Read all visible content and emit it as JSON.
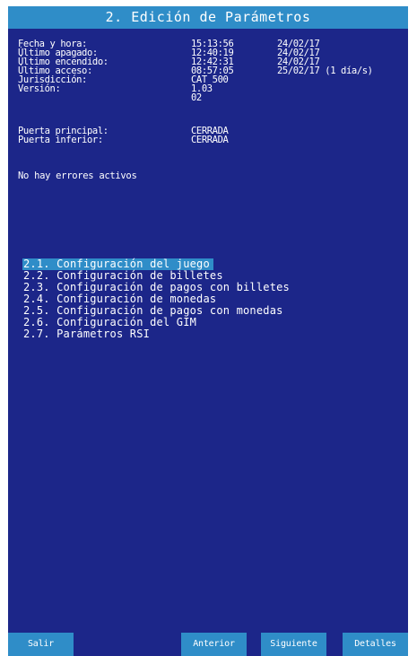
{
  "title": "2. Edición de Parámetros",
  "info": {
    "fecha_hora": {
      "label": "Fecha y hora:",
      "time": "15:13:56",
      "date": "24/02/17"
    },
    "ultimo_apagado": {
      "label": "Último apagado:",
      "time": "12:40:19",
      "date": "24/02/17"
    },
    "ultimo_encendido": {
      "label": "Último encendido:",
      "time": "12:42:31",
      "date": "24/02/17"
    },
    "ultimo_acceso": {
      "label": "Último acceso:",
      "time": "08:57:05",
      "date": "25/02/17 (1 día/s)"
    },
    "jurisdiccion": {
      "label": "Jurisdicción:",
      "value": "CAT 500"
    },
    "version": {
      "label": "Versión:",
      "value": "1.03",
      "value2": "02"
    },
    "puerta_principal": {
      "label": "Puerta principal:",
      "value": "CERRADA"
    },
    "puerta_inferior": {
      "label": "Puerta inferior:",
      "value": "CERRADA"
    }
  },
  "errors_message": "No hay errores activos",
  "menu": {
    "items": [
      {
        "label": "2.1. Configuración del juego",
        "selected": true
      },
      {
        "label": "2.2. Configuración de billetes"
      },
      {
        "label": "2.3. Configuración de pagos con billetes"
      },
      {
        "label": "2.4. Configuración de monedas"
      },
      {
        "label": "2.5. Configuración de pagos con monedas"
      },
      {
        "label": "2.6. Configuración del GIM"
      },
      {
        "label": "2.7. Parámetros RSI"
      }
    ]
  },
  "footer": {
    "salir": "Salir",
    "anterior": "Anterior",
    "siguiente": "Siguiente",
    "detalles": "Detalles"
  },
  "colors": {
    "background": "#1c2689",
    "accent": "#2f8dc8",
    "text": "#ffffff"
  }
}
